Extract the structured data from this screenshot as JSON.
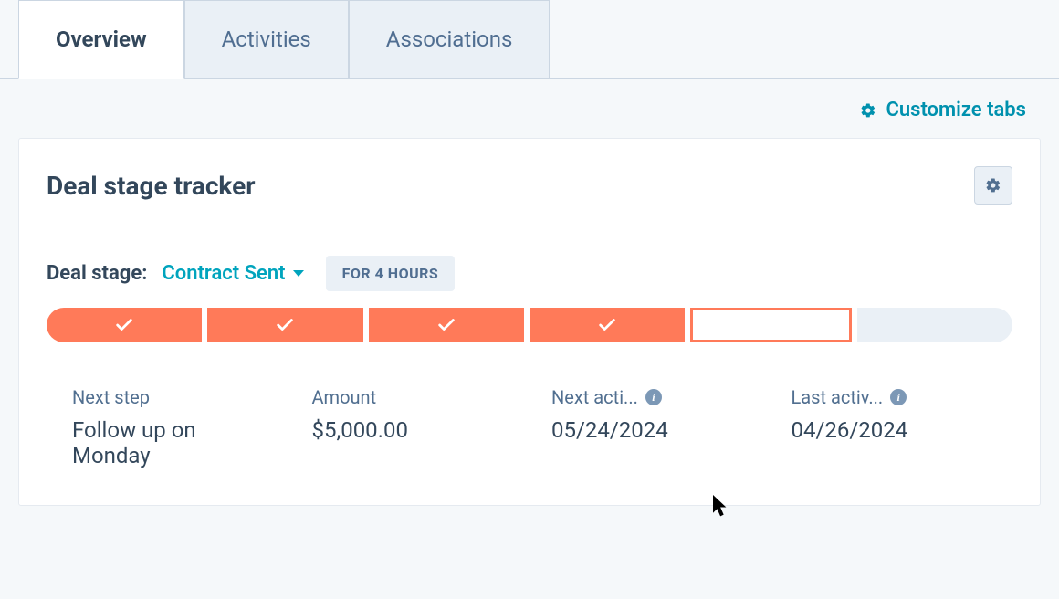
{
  "tabs": {
    "items": [
      {
        "label": "Overview",
        "active": true
      },
      {
        "label": "Activities",
        "active": false
      },
      {
        "label": "Associations",
        "active": false
      }
    ]
  },
  "customize": {
    "label": "Customize tabs"
  },
  "card": {
    "title": "Deal stage tracker",
    "stage_label": "Deal stage:",
    "stage_value": "Contract Sent",
    "duration_chip": "FOR 4 HOURS",
    "segments": [
      {
        "state": "done"
      },
      {
        "state": "done"
      },
      {
        "state": "done"
      },
      {
        "state": "done"
      },
      {
        "state": "current"
      },
      {
        "state": "future"
      }
    ],
    "details": [
      {
        "label": "Next step",
        "value": "Follow up on Monday",
        "info": false
      },
      {
        "label": "Amount",
        "value": "$5,000.00",
        "info": false
      },
      {
        "label": "Next acti...",
        "value": "05/24/2024",
        "info": true
      },
      {
        "label": "Last activ...",
        "value": "04/26/2024",
        "info": true
      }
    ]
  }
}
